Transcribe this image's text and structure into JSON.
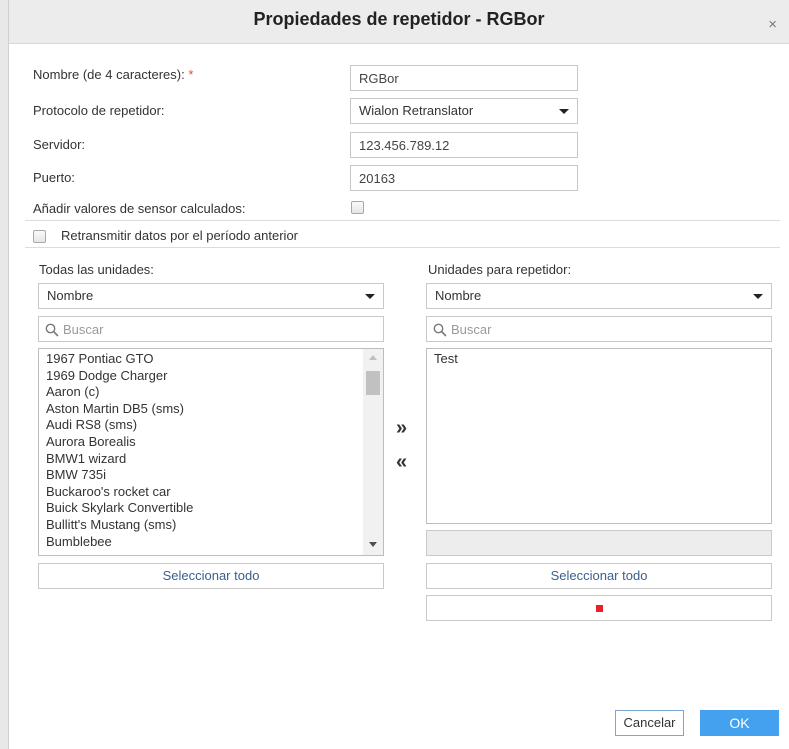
{
  "dialog": {
    "title": "Propiedades de repetidor - RGBor",
    "close_glyph": "×"
  },
  "form": {
    "name_label": "Nombre (de 4 caracteres):",
    "required_mark": "*",
    "name_value": "RGBor",
    "protocol_label": "Protocolo de repetidor:",
    "protocol_value": "Wialon Retranslator",
    "server_label": "Servidor:",
    "server_value": "123.456.789.12",
    "port_label": "Puerto:",
    "port_value": "20163",
    "add_sensors_label": "Añadir valores de sensor calculados:",
    "add_sensors_checked": false,
    "retransmit_label": "Retransmitir datos por el período anterior",
    "retransmit_checked": false
  },
  "all_units": {
    "heading": "Todas las unidades:",
    "sort_value": "Nombre",
    "search_placeholder": "Buscar",
    "items": [
      "1967 Pontiac GTO",
      "1969 Dodge Charger",
      "Aaron (c)",
      "Aston Martin DB5 (sms)",
      "Audi RS8 (sms)",
      "Aurora Borealis",
      "BMW1 wizard",
      "BMW 735i",
      "Buckaroo's rocket car",
      "Buick Skylark Convertible",
      "Bullitt's Mustang (sms)",
      "Bumblebee"
    ],
    "select_all_label": "Seleccionar todo"
  },
  "transfer": {
    "add_glyph": "»",
    "remove_glyph": "«"
  },
  "repeater_units": {
    "heading": "Unidades para repetidor:",
    "sort_value": "Nombre",
    "search_placeholder": "Buscar",
    "items": [
      "Test"
    ],
    "select_all_label": "Seleccionar todo"
  },
  "footer": {
    "cancel_label": "Cancelar",
    "ok_label": "OK"
  },
  "colors": {
    "required": "#e34b4b",
    "ok_button": "#43a1f0",
    "stop_square": "#e8202a",
    "link_text": "#3a5f8f"
  },
  "icons": {
    "close": "close-icon",
    "search": "search-icon",
    "dropdown": "chevron-down-icon",
    "add_units": "double-chevron-right-icon",
    "remove_units": "double-chevron-left-icon",
    "stop": "stop-icon"
  }
}
